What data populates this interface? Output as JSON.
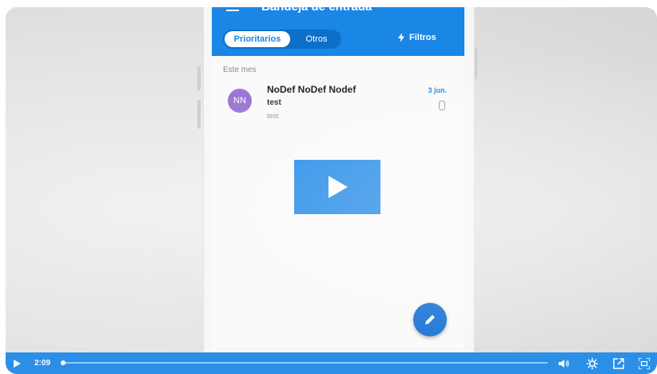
{
  "app": {
    "title": "Bandeja de entrada",
    "tabs": [
      {
        "label": "Prioritarios",
        "active": true
      },
      {
        "label": "Otros",
        "active": false
      }
    ],
    "filters_label": "Filtros",
    "section_header": "Este mes",
    "emails": [
      {
        "avatar_initials": "NN",
        "sender": "NoDef NoDef Nodef",
        "subject": "test",
        "preview": "test",
        "date": "3 jun.",
        "has_attachment": true
      }
    ]
  },
  "player": {
    "current_time": "2:09",
    "progress": 0.0,
    "icons": [
      "play-icon",
      "volume-icon",
      "settings-icon",
      "share-icon",
      "fullscreen-icon"
    ]
  },
  "colors": {
    "brand_blue": "#1a86e6",
    "player_bar": "#2b8fe8",
    "avatar": "#9c78d6"
  }
}
